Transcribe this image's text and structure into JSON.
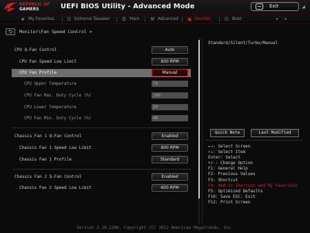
{
  "header": {
    "brand_line1": "REPUBLIC OF",
    "brand_line2": "GAMERS",
    "title": "UEFI BIOS Utility - Advanced Mode",
    "exit_label": "Exit"
  },
  "tabs": [
    {
      "label": "My Favorites",
      "icon": "star-icon"
    },
    {
      "label": "Extreme Tweaker",
      "icon": "tweaker-icon"
    },
    {
      "label": "Main",
      "icon": "list-icon"
    },
    {
      "label": "Advanced",
      "icon": "wrench-icon"
    },
    {
      "label": "Monitor",
      "icon": "monitor-icon"
    },
    {
      "label": "Boot",
      "icon": "power-icon"
    }
  ],
  "breadcrumb": "Monitor\\Fan Speed Control >",
  "settings": {
    "cpu_qfan": {
      "label": "CPU Q-Fan Control",
      "value": "Auto"
    },
    "cpu_fan_low": {
      "label": "CPU Fan Speed Low Limit",
      "value": "600 RPM"
    },
    "cpu_fan_profile": {
      "label": "CPU Fan Profile",
      "value": "Manual"
    },
    "cpu_upper_temp": {
      "label": "CPU Upper Temperature",
      "value": "70"
    },
    "cpu_max_duty": {
      "label": "CPU Fan Max. Duty Cycle (%)",
      "value": "100"
    },
    "cpu_lower_temp": {
      "label": "CPU Lower Temperature",
      "value": "20"
    },
    "cpu_min_duty": {
      "label": "CPU Fan Min. Duty Cycle (%)",
      "value": "40"
    },
    "ch1_qfan": {
      "label": "Chassis Fan 1 Q-Fan Control",
      "value": "Enabled"
    },
    "ch1_low": {
      "label": "Chassis Fan 1 Speed Low Limit",
      "value": "600 RPM"
    },
    "ch1_profile": {
      "label": "Chassis Fan 1 Profile",
      "value": "Standard"
    },
    "ch2_qfan": {
      "label": "Chassis Fan 2 Q-Fan Control",
      "value": "Enabled"
    },
    "ch2_low": {
      "label": "Chassis Fan 2 Speed Low Limit",
      "value": "600 RPM"
    }
  },
  "help": {
    "description": "Standard/Silent/Turbo/Manual",
    "quick_note": "Quick Note",
    "last_modified": "Last Modified",
    "keys": [
      "←→: Select Screen",
      "↑↓: Select Item",
      "Enter: Select",
      "+/-: Change Option",
      "F1: General Help",
      "F2: Previous Values",
      "F3: Shortcut",
      "F4: Add to Shortcut and My Favorites",
      "F5: Optimized Defaults",
      "F10: Save  ESC: Exit",
      "F12: Print Screen"
    ]
  },
  "footer": "Version 2.10.1208. Copyright (C) 2013 American Megatrends, Inc.",
  "colors": {
    "accent": "#d12525",
    "background": "#0b0b0c",
    "selected_row": "#6e6e6e"
  }
}
